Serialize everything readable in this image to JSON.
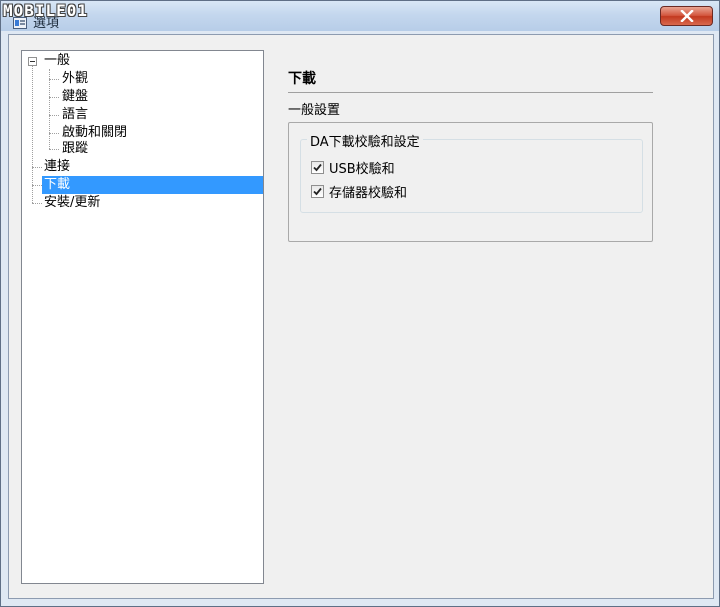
{
  "watermark": "MOBILE01",
  "window": {
    "title": "選項",
    "close_icon": "close-x-icon"
  },
  "tree": {
    "items": [
      {
        "label": "一般",
        "level": 0,
        "expanded": true
      },
      {
        "label": "外觀",
        "level": 1
      },
      {
        "label": "鍵盤",
        "level": 1
      },
      {
        "label": "語言",
        "level": 1
      },
      {
        "label": "啟動和關閉",
        "level": 1
      },
      {
        "label": "跟蹤",
        "level": 1
      },
      {
        "label": "連接",
        "level": 0
      },
      {
        "label": "下載",
        "level": 0,
        "selected": true
      },
      {
        "label": "安裝/更新",
        "level": 0
      }
    ]
  },
  "panel": {
    "title": "下載",
    "section": "一般設置",
    "group": {
      "legend": "DA下載校驗和設定",
      "options": [
        {
          "label": "USB校驗和",
          "checked": true
        },
        {
          "label": "存儲器校驗和",
          "checked": true
        }
      ]
    }
  },
  "colors": {
    "selection": "#3399ff",
    "close_button": "#c2391f"
  }
}
